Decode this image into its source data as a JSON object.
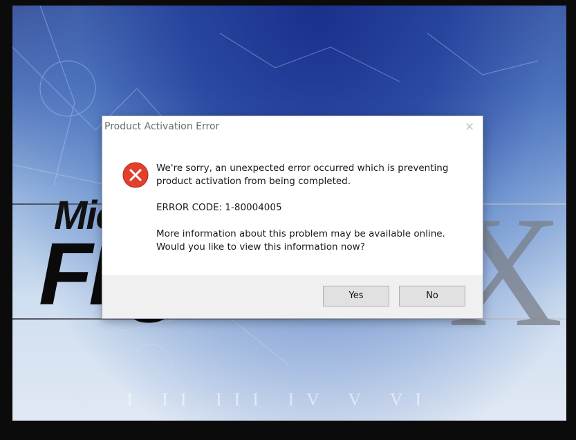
{
  "background": {
    "logo_micro": "Micr",
    "logo_flight": "Flig",
    "logo_x": "X",
    "numerals": "I II III IV V VI"
  },
  "dialog": {
    "title": "Product Activation Error",
    "close_icon": "close-icon",
    "error_icon": "error-icon",
    "error_icon_color": "#e0402c",
    "message_1": "We're sorry, an unexpected error occurred which is preventing product activation from being completed.",
    "error_code": "ERROR CODE: 1-80004005",
    "message_2": "More information about this problem may be available online. Would you like to view this information now?",
    "buttons": {
      "yes_label": "Yes",
      "no_label": "No"
    }
  }
}
